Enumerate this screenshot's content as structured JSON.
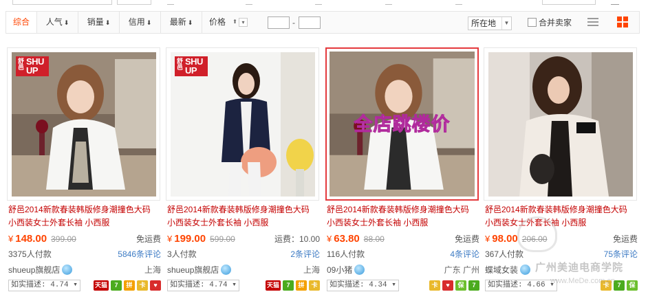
{
  "sort_bar": {
    "tabs": [
      {
        "label": "综合",
        "arrow": ""
      },
      {
        "label": "人气",
        "arrow": "⬇"
      },
      {
        "label": "销量",
        "arrow": "⬇"
      },
      {
        "label": "信用",
        "arrow": "⬇"
      },
      {
        "label": "最新",
        "arrow": "⬇"
      }
    ],
    "price_label": "价格",
    "price_arrow": "⬆",
    "price_from": "",
    "price_to": "",
    "price_dash": "-",
    "location_label": "所在地",
    "merge_label": "合并卖家",
    "accent_color": "#ff4400"
  },
  "products": [
    {
      "title_line1": "舒邑2014新款春装韩版修身潮撞色大码",
      "title_line2": "小西装女士外套长袖 小西服",
      "currency": "¥",
      "price": "148.00",
      "original_price": "399.00",
      "shipping": "免运费",
      "sales": "3375人付款",
      "comments": "5846条评论",
      "shop": "shueup旗舰店",
      "location": "上海",
      "rating": "如实描述: 4.74",
      "logo_text": "SHU UP",
      "logo_side": "舒邑",
      "promo": "",
      "badges": [
        "天猫",
        "7",
        "拼",
        "卡",
        "♥"
      ]
    },
    {
      "title_line1": "舒邑2014新款春装韩版修身潮撞色大码",
      "title_line2": "小西装女士外套长袖 小西服",
      "currency": "¥",
      "price": "199.00",
      "original_price": "599.00",
      "shipping": "运费：10.00",
      "sales": "3人付款",
      "comments": "2条评论",
      "shop": "shueup旗舰店",
      "location": "上海",
      "rating": "如实描述: 4.74",
      "logo_text": "SHU UP",
      "logo_side": "舒邑",
      "promo": "",
      "badges": [
        "天猫",
        "7",
        "拼",
        "卡"
      ]
    },
    {
      "title_line1": "舒邑2014新款春装韩版修身潮撞色大码",
      "title_line2": "小西装女士外套长袖 小西服",
      "currency": "¥",
      "price": "63.80",
      "original_price": "88.00",
      "shipping": "免运费",
      "sales": "116人付款",
      "comments": "4条评论",
      "shop": "09小猪",
      "location": "广东 广州",
      "rating": "如实描述: 4.34",
      "logo_text": "",
      "logo_side": "",
      "promo": "全店跳楼价",
      "badges": [
        "卡",
        "♥",
        "保",
        "7"
      ]
    },
    {
      "title_line1": "舒邑2014新款春装韩版修身潮撞色大码",
      "title_line2": "小西装女士外套长袖 小西服",
      "currency": "¥",
      "price": "98.00",
      "original_price": "206.00",
      "shipping": "免运费",
      "sales": "367人付款",
      "comments": "75条评论",
      "shop": "蝶域女装",
      "location": "",
      "rating": "如实描述: 4.66",
      "logo_text": "",
      "logo_side": "",
      "promo": "",
      "badges": [
        "卡",
        "7",
        "保"
      ]
    }
  ],
  "watermark": {
    "line1": "广州美迪电商学院",
    "line2": "www.MeDe.com.cn"
  }
}
